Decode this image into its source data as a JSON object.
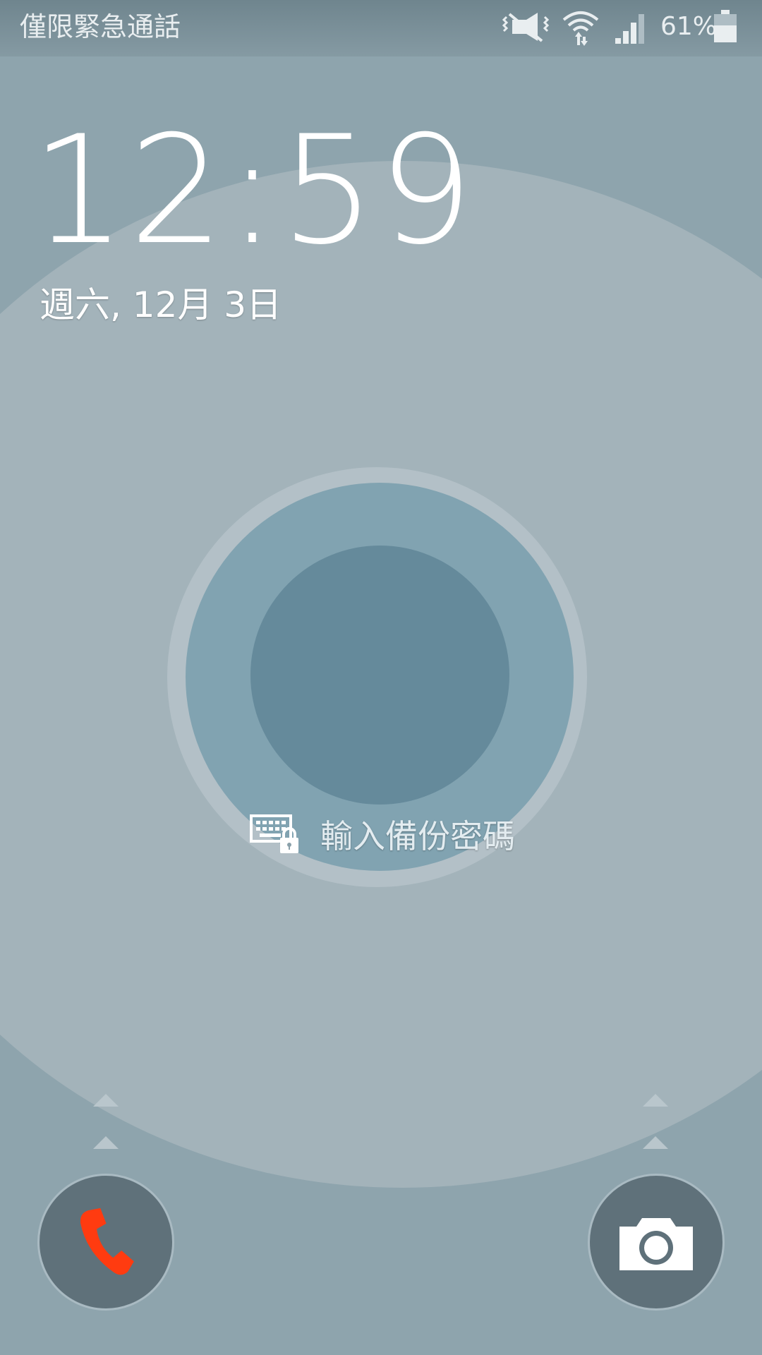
{
  "status_bar": {
    "carrier_text": "僅限緊急通話",
    "battery_percent": "61%",
    "battery_level": 0.61,
    "icons": [
      "vibrate-mute-icon",
      "wifi-icon",
      "signal-icon",
      "battery-icon"
    ]
  },
  "lockscreen": {
    "time": "12:59",
    "date": "週六, 12月 3日",
    "backup_password_label": "輸入備份密碼"
  },
  "shortcuts": {
    "left": {
      "icon": "phone-icon",
      "color": "#ff3b10"
    },
    "right": {
      "icon": "camera-icon"
    }
  },
  "colors": {
    "background": "#8ea4ad",
    "halo": "#a3b3ba",
    "lock_mid": "#81a3b1",
    "lock_inner": "#658a9b"
  }
}
